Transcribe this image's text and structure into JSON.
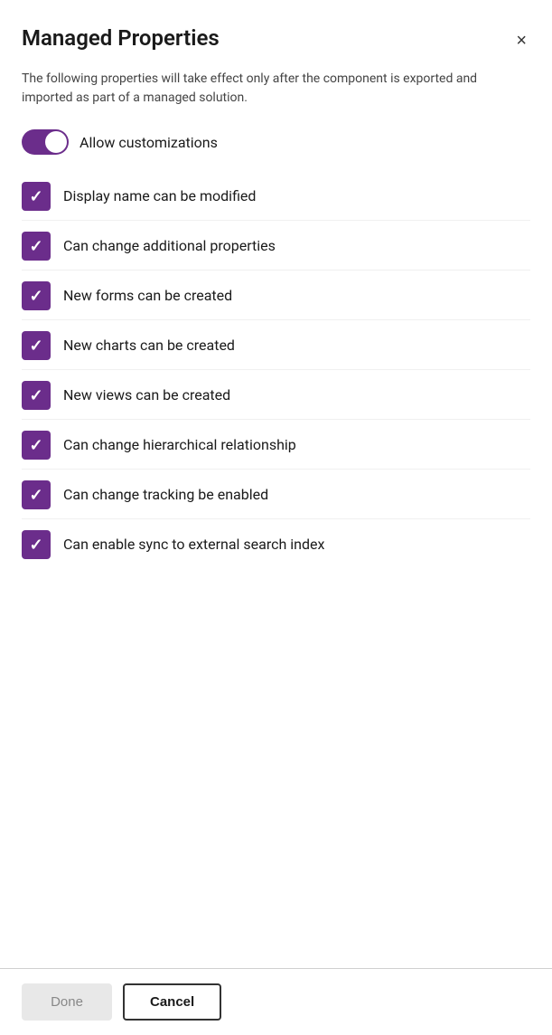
{
  "dialog": {
    "title": "Managed Properties",
    "description": "The following properties will take effect only after the component is exported and imported as part of a managed solution.",
    "close_label": "×"
  },
  "toggle": {
    "label": "Allow customizations",
    "enabled": true
  },
  "checkboxes": [
    {
      "id": "display-name",
      "label": "Display name can be modified",
      "checked": true
    },
    {
      "id": "additional-props",
      "label": "Can change additional properties",
      "checked": true
    },
    {
      "id": "new-forms",
      "label": "New forms can be created",
      "checked": true
    },
    {
      "id": "new-charts",
      "label": "New charts can be created",
      "checked": true
    },
    {
      "id": "new-views",
      "label": "New views can be created",
      "checked": true
    },
    {
      "id": "hierarchical",
      "label": "Can change hierarchical relationship",
      "checked": true
    },
    {
      "id": "tracking",
      "label": "Can change tracking be enabled",
      "checked": true
    },
    {
      "id": "sync-search",
      "label": "Can enable sync to external search index",
      "checked": true
    }
  ],
  "footer": {
    "done_label": "Done",
    "cancel_label": "Cancel"
  }
}
